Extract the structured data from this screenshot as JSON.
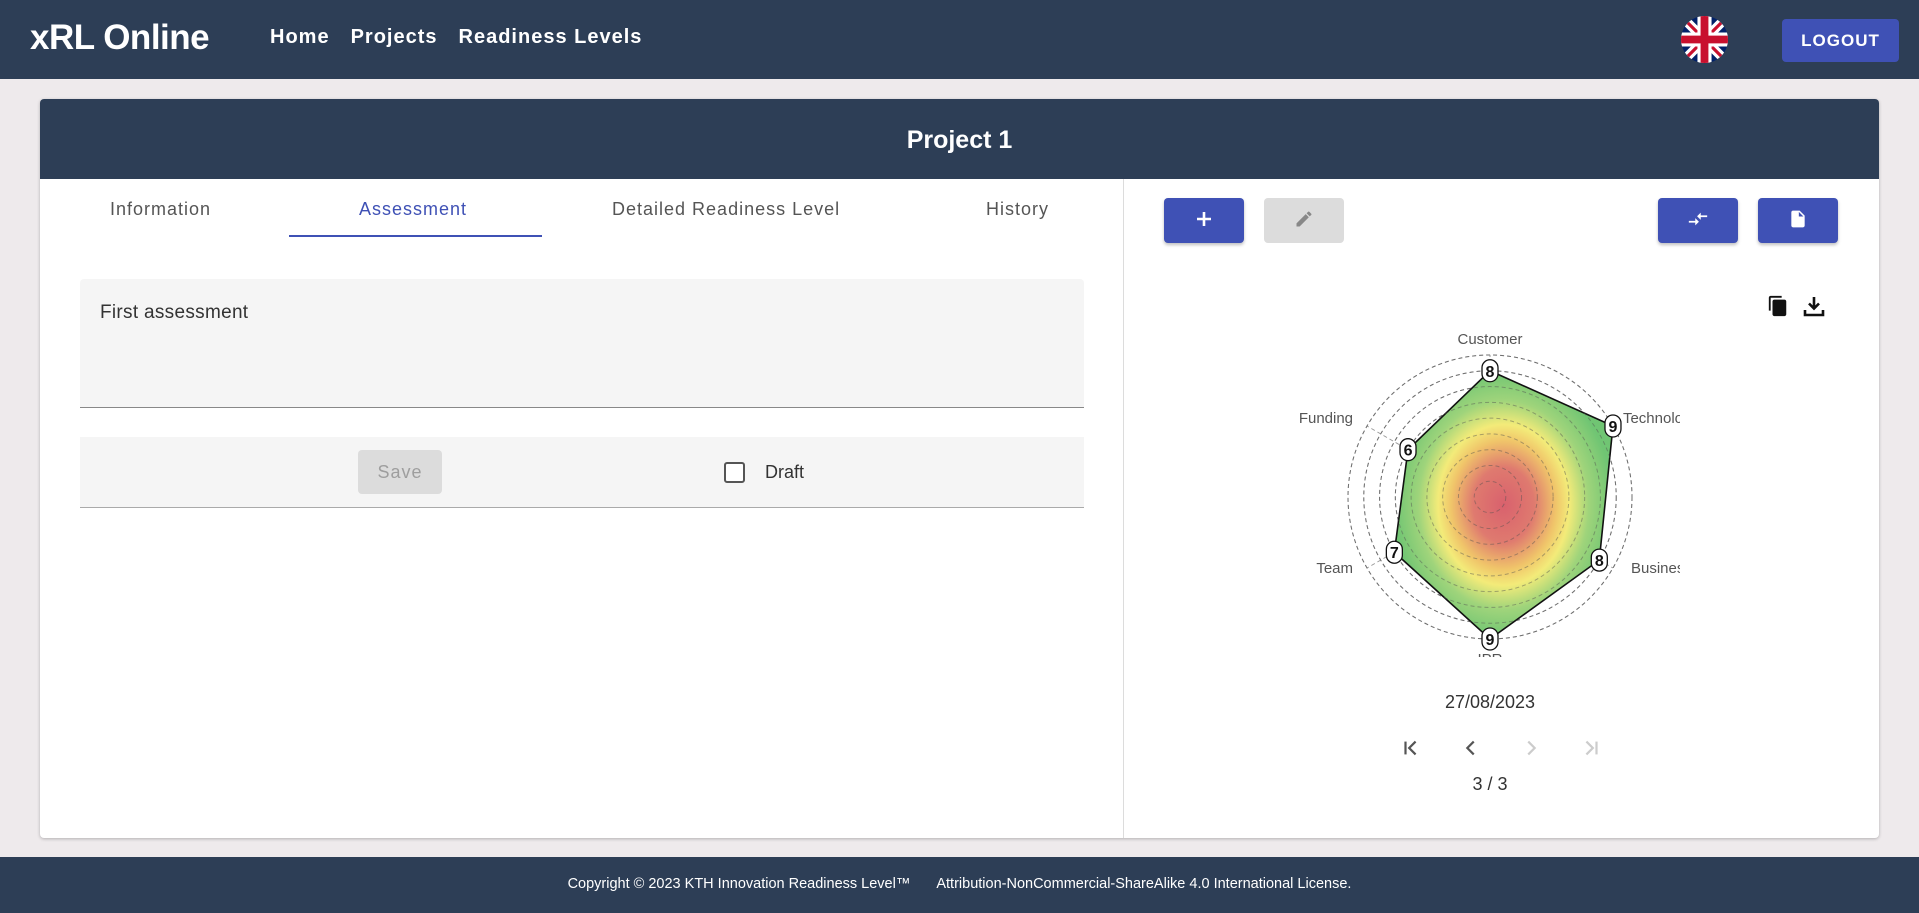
{
  "app": {
    "title": "xRL Online"
  },
  "nav": {
    "items": [
      {
        "label": "Home"
      },
      {
        "label": "Projects"
      },
      {
        "label": "Readiness Levels"
      }
    ]
  },
  "header": {
    "logout_label": "LOGOUT",
    "language_icon": "uk-flag-icon"
  },
  "project": {
    "title": "Project 1"
  },
  "tabs": [
    {
      "label": "Information",
      "active": false
    },
    {
      "label": "Assessment",
      "active": true
    },
    {
      "label": "Detailed Readiness Level",
      "active": false
    },
    {
      "label": "History",
      "active": false
    }
  ],
  "assessment": {
    "comment_value": "First assessment",
    "save_label": "Save",
    "draft_label": "Draft",
    "draft_checked": false
  },
  "toolbar": {
    "add_icon": "plus-icon",
    "edit_icon": "pencil-icon",
    "compare_icon": "compare-arrows-icon",
    "report_icon": "document-icon",
    "copy_icon": "copy-icon",
    "download_icon": "download-icon"
  },
  "chart_data": {
    "type": "radar",
    "categories": [
      "Customer",
      "Technology",
      "Business Model",
      "IPR",
      "Team",
      "Funding"
    ],
    "values": [
      8,
      9,
      8,
      9,
      7,
      6
    ],
    "rlim": [
      0,
      9
    ],
    "grid": true
  },
  "assessment_nav": {
    "date": "27/08/2023",
    "page_label": "3 / 3",
    "first_icon": "first-page-icon",
    "prev_icon": "chevron-left-icon",
    "next_icon": "chevron-right-icon",
    "last_icon": "last-page-icon"
  },
  "footer": {
    "copyright": "Copyright © 2023 KTH Innovation Readiness Level™",
    "license": "Attribution-NonCommercial-ShareAlike 4.0 International License."
  },
  "colors": {
    "primary": "#3f51b5",
    "navy": "#2d3e56",
    "background": "#eeeaec"
  }
}
